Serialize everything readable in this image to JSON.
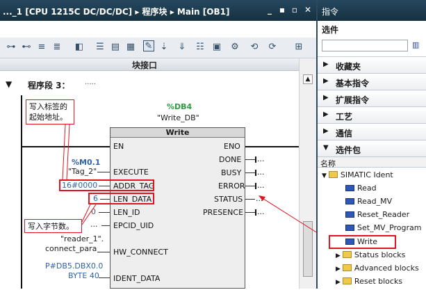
{
  "editor": {
    "title": "..._1 [CPU 1215C DC/DC/DC] ▸ 程序块 ▸ Main [OB1]",
    "interface_label": "块接口",
    "segment_label": "程序段 3：",
    "segment_comment": "....."
  },
  "block": {
    "db_address": "%DB4",
    "db_name": "\"Write_DB\"",
    "name": "Write",
    "inputs": [
      "EN",
      "EXECUTE",
      "ADDR_TAG",
      "LEN_DATA",
      "LEN_ID",
      "EPCID_UID",
      "HW_CONNECT",
      "IDENT_DATA"
    ],
    "outputs": [
      "ENO",
      "DONE",
      "BUSY",
      "ERROR",
      "STATUS",
      "PRESENCE"
    ],
    "output_stub": "...",
    "params": {
      "execute_addr": "%M0.1",
      "execute_tag": "\"Tag_2\"",
      "addr_tag": "16#0000",
      "len_data": "6",
      "len_id": "0",
      "epcid_uid": "...",
      "hw_connect_1": "\"reader_1\".",
      "hw_connect_2": "connect_para",
      "ident_data_1": "P#DB5.DBX0.0",
      "ident_data_2": "BYTE 40"
    }
  },
  "callouts": {
    "top": [
      "写入标签的",
      "起始地址。"
    ],
    "bottom": "写入字节数。"
  },
  "panel": {
    "title": "指令",
    "options_label": "选件",
    "categories": [
      "收藏夹",
      "基本指令",
      "扩展指令",
      "工艺",
      "通信",
      "选件包"
    ],
    "column_header": "名称",
    "tree": {
      "root": "SIMATIC Ident",
      "items": [
        "Read",
        "Read_MV",
        "Reset_Reader",
        "Set_MV_Program",
        "Write"
      ],
      "folders": [
        "Status blocks",
        "Advanced blocks",
        "Reset blocks"
      ]
    }
  },
  "colors": {
    "titlebar": "#1b3a4d",
    "highlight": "#e0141e",
    "db_green": "#2d9c3c",
    "address_blue": "#2f62a9"
  }
}
